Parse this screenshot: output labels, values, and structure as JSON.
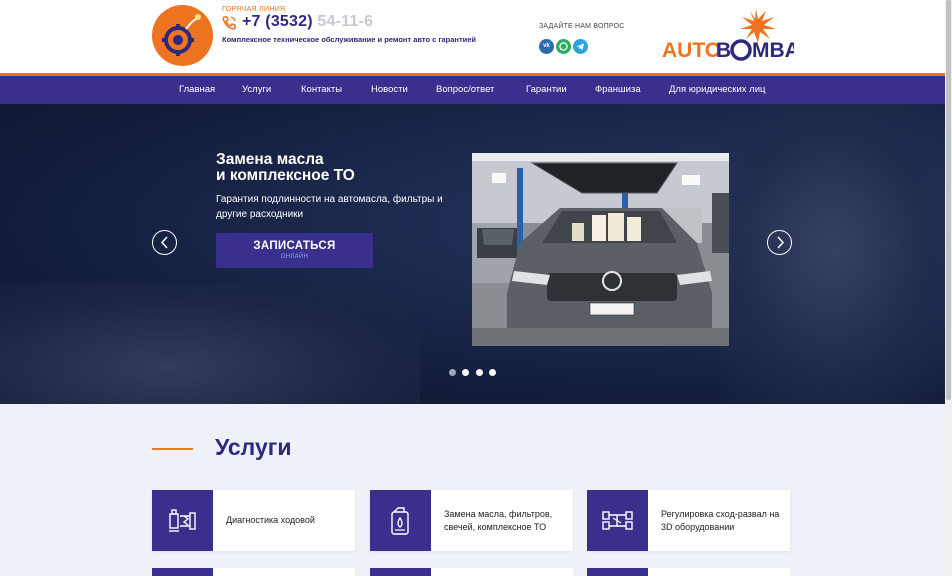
{
  "header": {
    "hotline_label": "ГОРЯЧАЯ ЛИНИЯ",
    "phone_main": "+7 (3532)",
    "phone_rest": "54-11-6",
    "tagline": "Комплексное техническое обслуживание и ремонт авто с гарантией",
    "ask_label": "ЗАДАЙТЕ НАМ ВОПРОС",
    "socials": [
      {
        "name": "vk",
        "text": "vk"
      },
      {
        "name": "whatsapp",
        "text": ""
      },
      {
        "name": "telegram",
        "text": ""
      }
    ],
    "brand": {
      "part1": "AUTO",
      "part2": "B",
      "part3": "MBA"
    }
  },
  "nav": {
    "items": [
      {
        "label": "Главная"
      },
      {
        "label": "Услуги"
      },
      {
        "label": "Контакты"
      },
      {
        "label": "Новости"
      },
      {
        "label": "Вопрос/ответ"
      },
      {
        "label": "Гарантии"
      },
      {
        "label": "Франшиза"
      },
      {
        "label": "Для юридических лиц"
      }
    ]
  },
  "hero": {
    "title_line1": "Замена масла",
    "title_line2": "и комплексное ТО",
    "subtitle": "Гарантия подлинности на автомасла, фильтры и другие расходники",
    "cta_main": "ЗАПИСАТЬСЯ",
    "cta_sub": "ОНЛАЙН",
    "slides_total": 4,
    "active_slide": 1
  },
  "services": {
    "title": "Услуги",
    "cards": [
      {
        "label": "Диагностика ходовой",
        "icon": "suspension-icon"
      },
      {
        "label": "Замена масла, фильтров, свечей, комплексное ТО",
        "icon": "oil-canister-icon"
      },
      {
        "label": "Регулировка сход-развал на 3D оборудовании",
        "icon": "wheel-alignment-icon"
      }
    ]
  },
  "colors": {
    "accent": "#ee7422",
    "brand_navy": "#38308c",
    "title_navy": "#2d2a7e",
    "services_bg": "#edf2f8"
  }
}
